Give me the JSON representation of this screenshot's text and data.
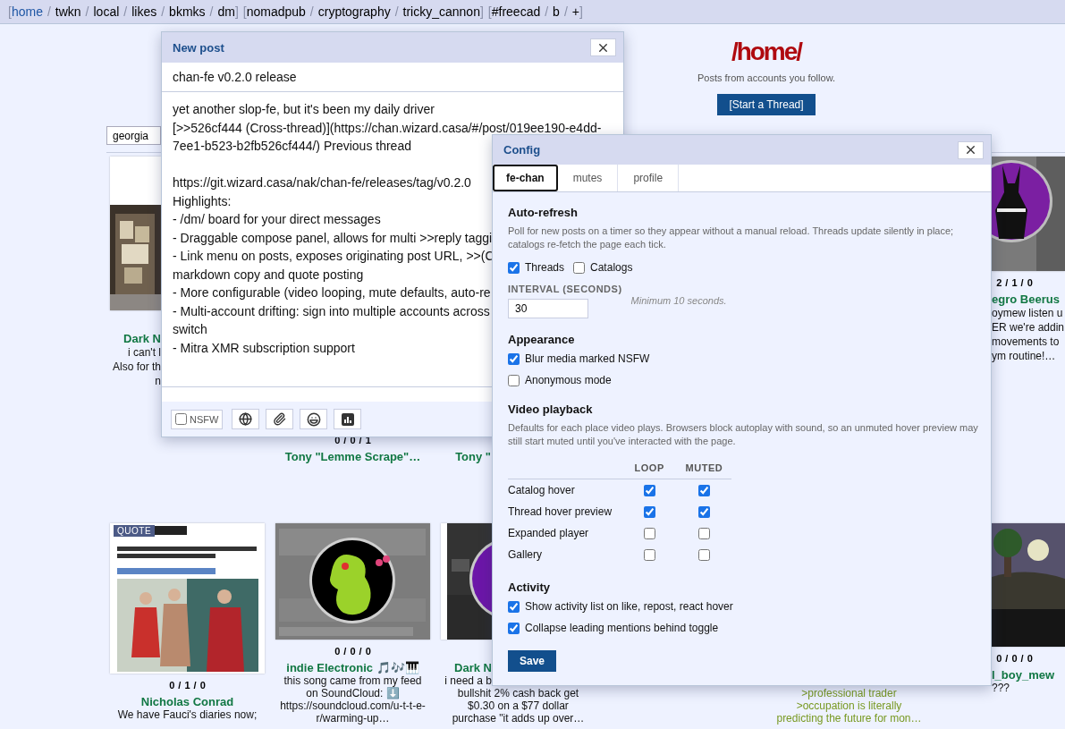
{
  "nav": [
    [
      {
        "kind": "bracket",
        "text": "["
      },
      {
        "kind": "link",
        "text": "home",
        "selected": true
      },
      {
        "kind": "separator",
        "text": "/"
      },
      {
        "kind": "link",
        "text": "twkn",
        "selected": false
      },
      {
        "kind": "separator",
        "text": "/"
      },
      {
        "kind": "link",
        "text": "local",
        "selected": false
      },
      {
        "kind": "separator",
        "text": "/"
      },
      {
        "kind": "link",
        "text": "likes",
        "selected": false
      },
      {
        "kind": "separator",
        "text": "/"
      },
      {
        "kind": "link",
        "text": "bkmks",
        "selected": false
      },
      {
        "kind": "separator",
        "text": "/"
      },
      {
        "kind": "link",
        "text": "dm",
        "selected": false
      },
      {
        "kind": "bracket",
        "text": "]"
      }
    ],
    [
      {
        "kind": "bracket",
        "text": "["
      },
      {
        "kind": "link",
        "text": "nomadpub",
        "selected": false
      },
      {
        "kind": "separator",
        "text": "/"
      },
      {
        "kind": "link",
        "text": "cryptography",
        "selected": false
      },
      {
        "kind": "separator",
        "text": "/"
      },
      {
        "kind": "link",
        "text": "tricky_cannon",
        "selected": false
      },
      {
        "kind": "bracket",
        "text": "]"
      }
    ],
    [
      {
        "kind": "bracket",
        "text": "["
      },
      {
        "kind": "link",
        "text": "#freecad",
        "selected": false
      },
      {
        "kind": "separator",
        "text": "/"
      },
      {
        "kind": "link",
        "text": "b",
        "selected": false
      },
      {
        "kind": "separator",
        "text": "/"
      },
      {
        "kind": "link",
        "text": "+",
        "selected": false
      },
      {
        "kind": "bracket",
        "text": "]"
      }
    ]
  ],
  "header": {
    "title": "/home/",
    "subtitle": "Posts from accounts you follow.",
    "button": "[Start a Thread]"
  },
  "search": {
    "value": "georgia"
  },
  "catalog": [
    [
      {
        "media": {
          "kind": "picture"
        },
        "name": "Dark N",
        "lines": [
          {
            "kind": "text",
            "text": "i can't l"
          },
          {
            "kind": "text",
            "text": "Also for th"
          },
          {
            "kind": "text",
            "text": "n"
          }
        ]
      },
      {
        "stats": "0 / 0 / 1",
        "name": "Tony \"Lemme Scrape\"…"
      },
      {
        "name": "Tony \""
      },
      {
        "media": {
          "kind": "picture"
        },
        "stats": "2 / 1 / 0",
        "name": "egro Beerus",
        "lines": [
          {
            "kind": "text",
            "text": "oymew listen u"
          },
          {
            "kind": "text",
            "text": "ER we're addin"
          },
          {
            "kind": "text",
            "text": "movements to"
          },
          {
            "kind": "text",
            "text": "ym routine!…"
          }
        ]
      }
    ],
    [
      {
        "media": {
          "kind": "picture"
        },
        "badge": "QUOTE",
        "stats": "0 / 1 / 0",
        "name": "Nicholas Conrad",
        "lines": [
          {
            "kind": "text",
            "text": "We have Fauci's diaries now;"
          }
        ]
      },
      {
        "media": {
          "kind": "picture"
        },
        "stats": "0 / 0 / 0",
        "name": "indie Electronic 🎵🎶🎹",
        "lines": [
          {
            "kind": "text",
            "text": "this song came from my feed"
          },
          {
            "kind": "text",
            "text": "on SoundCloud: ⬇️"
          },
          {
            "kind": "text",
            "text": "https://soundcloud.com/u-t-t-e-"
          },
          {
            "kind": "text",
            "text": "r/warming-up…"
          }
        ]
      },
      {
        "media": {
          "kind": "picture"
        },
        "name": "Dark N",
        "lines": [
          {
            "kind": "text",
            "text": "i need a b"
          },
          {
            "kind": "text",
            "text": "bullshit 2% cash back get"
          },
          {
            "kind": "text",
            "text": "$0.30 on a $77 dollar"
          },
          {
            "kind": "text",
            "text": "purchase \"it adds up over…"
          }
        ]
      },
      {
        "lines": [
          {
            "kind": "quote",
            "text": ">professional trader"
          },
          {
            "kind": "quote",
            "text": ">occupation is literally"
          },
          {
            "kind": "quote",
            "text": "predicting the future for mon…"
          }
        ]
      },
      {
        "media": {
          "kind": "picture"
        },
        "stats": "0 / 0 / 0",
        "name": "l_boy_mew",
        "lines": [
          {
            "kind": "text",
            "text": "???"
          }
        ]
      }
    ]
  ],
  "compose": {
    "title": "New post",
    "subject": "chan-fe v0.2.0 release",
    "body": [
      [
        "yet another slop-fe, but it's been my daily driver",
        "[>>526cf444 (Cross-thread)](https://chan.wizard.casa/#/post/019ee190-e4dd-",
        "7ee1-b523-b2fb526cf444/) Previous thread"
      ],
      [
        "https://git.wizard.casa/nak/chan-fe/releases/tag/v0.2.0",
        "Highlights:",
        "- /dm/ board for your direct messages",
        "- Draggable compose panel, allows for multi >>reply taggi",
        "- Link menu on posts, exposes originating post URL, >>(C",
        "markdown copy and quote posting",
        "- More configurable (video looping, mute defaults, auto-re",
        "- Multi-account drifting: sign into multiple accounts across",
        "switch",
        "- Mitra XMR subscription support"
      ]
    ],
    "nsfw": {
      "label": "NSFW",
      "checked": false
    }
  },
  "config": {
    "title": "Config",
    "tabs": [
      {
        "label": "fe-chan",
        "selected": true
      },
      {
        "label": "mutes",
        "selected": false
      },
      {
        "label": "profile",
        "selected": false
      }
    ],
    "sections": [
      {
        "kind": "auto_refresh",
        "title": "Auto-refresh",
        "description": "Poll for new posts on a timer so they appear without a manual reload. Threads update silently in place; catalogs re-fetch the page each tick.",
        "options": [
          {
            "label": "Threads",
            "checked": true
          },
          {
            "label": "Catalogs",
            "checked": false
          }
        ],
        "interval": {
          "label": "INTERVAL (SECONDS)",
          "value": "30",
          "hint": "Minimum 10 seconds."
        }
      },
      {
        "kind": "toggles",
        "title": "Appearance",
        "options": [
          {
            "label": "Blur media marked NSFW",
            "checked": true
          },
          {
            "label": "Anonymous mode",
            "checked": false
          }
        ]
      },
      {
        "kind": "matrix",
        "title": "Video playback",
        "description": "Defaults for each place video plays. Browsers block autoplay with sound, so an unmuted hover preview may still start muted until you've interacted with the page.",
        "columns": [
          "LOOP",
          "MUTED"
        ],
        "rows": [
          {
            "label": "Catalog hover",
            "loop": true,
            "muted": true
          },
          {
            "label": "Thread hover preview",
            "loop": true,
            "muted": true
          },
          {
            "label": "Expanded player",
            "loop": false,
            "muted": false
          },
          {
            "label": "Gallery",
            "loop": false,
            "muted": false
          }
        ]
      },
      {
        "kind": "toggles",
        "title": "Activity",
        "options": [
          {
            "label": "Show activity list on like, repost, react hover",
            "checked": true
          },
          {
            "label": "Collapse leading mentions behind toggle",
            "checked": true
          }
        ]
      }
    ],
    "save": "Save"
  }
}
